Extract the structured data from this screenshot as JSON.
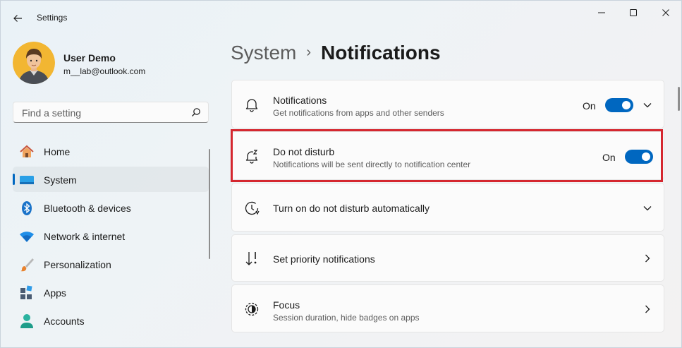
{
  "window": {
    "app_title": "Settings",
    "icons": {
      "back": "back-arrow-icon",
      "minimize": "minimize-icon",
      "maximize": "maximize-icon",
      "close": "close-icon"
    }
  },
  "profile": {
    "name": "User Demo",
    "email": "m__lab@outlook.com"
  },
  "search": {
    "placeholder": "Find a setting",
    "value": ""
  },
  "sidebar": {
    "items": [
      {
        "label": "Home",
        "icon": "home-icon",
        "selected": false
      },
      {
        "label": "System",
        "icon": "system-monitor-icon",
        "selected": true
      },
      {
        "label": "Bluetooth & devices",
        "icon": "bluetooth-icon",
        "selected": false
      },
      {
        "label": "Network & internet",
        "icon": "wifi-icon",
        "selected": false
      },
      {
        "label": "Personalization",
        "icon": "brush-icon",
        "selected": false
      },
      {
        "label": "Apps",
        "icon": "apps-icon",
        "selected": false
      },
      {
        "label": "Accounts",
        "icon": "accounts-icon",
        "selected": false
      }
    ]
  },
  "breadcrumb": {
    "parent": "System",
    "separator": "›",
    "current": "Notifications"
  },
  "cards": [
    {
      "title": "Notifications",
      "subtitle": "Get notifications from apps and other senders",
      "state_label": "On",
      "toggle_on": true,
      "icon": "bell-icon",
      "chevron": "chevron-down-icon"
    },
    {
      "title": "Do not disturb",
      "subtitle": "Notifications will be sent directly to notification center",
      "state_label": "On",
      "toggle_on": true,
      "icon": "bell-snooze-icon",
      "highlighted": true
    },
    {
      "title": "Turn on do not disturb automatically",
      "icon": "clock-icon",
      "chevron": "chevron-down-icon"
    },
    {
      "title": "Set priority notifications",
      "icon": "sort-priority-icon",
      "chevron": "chevron-right-icon"
    },
    {
      "title": "Focus",
      "subtitle": "Session duration, hide badges on apps",
      "icon": "focus-icon",
      "chevron": "chevron-right-icon"
    }
  ],
  "colors": {
    "accent": "#0067c0",
    "highlight": "#d5272f"
  }
}
